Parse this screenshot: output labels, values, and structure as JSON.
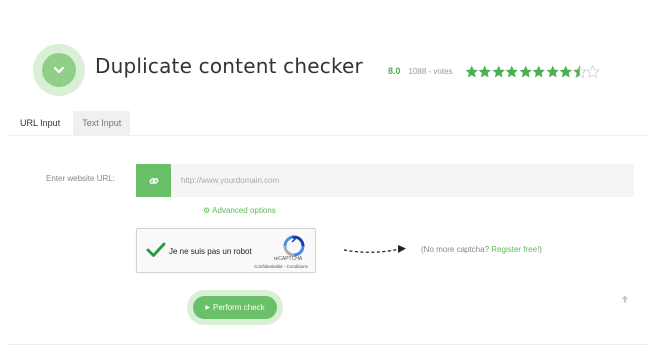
{
  "header": {
    "title": "Duplicate content checker",
    "logo_icon": "chevron-down-icon"
  },
  "rating": {
    "score": "8.0",
    "votes": "1088 - votes",
    "stars": [
      {
        "state": "full"
      },
      {
        "state": "full"
      },
      {
        "state": "full"
      },
      {
        "state": "full"
      },
      {
        "state": "full"
      },
      {
        "state": "full"
      },
      {
        "state": "full"
      },
      {
        "state": "full"
      },
      {
        "state": "half"
      },
      {
        "state": "empty"
      }
    ],
    "color": "#4caf50"
  },
  "tabs": [
    {
      "label": "URL Input",
      "active": true
    },
    {
      "label": "Text Input",
      "active": false
    }
  ],
  "form": {
    "url_label": "Enter website URL:",
    "url_placeholder": "http://www.yourdomain.com",
    "url_value": "",
    "link_icon": "link-icon",
    "advanced_label": "Advanced options",
    "advanced_icon": "gear-icon"
  },
  "captcha": {
    "label": "Je ne suis pas un robot",
    "brand": "reCAPTCHA",
    "links": "Confidentialité - Conditions",
    "checked": true
  },
  "no_captcha": {
    "prefix": "(No more captcha? ",
    "link": "Register free!",
    "suffix": ")"
  },
  "actions": {
    "perform_label": "Perform check"
  },
  "colors": {
    "accent": "#6abf69",
    "accent_light": "#d9efd6",
    "link": "#5cb85c"
  }
}
